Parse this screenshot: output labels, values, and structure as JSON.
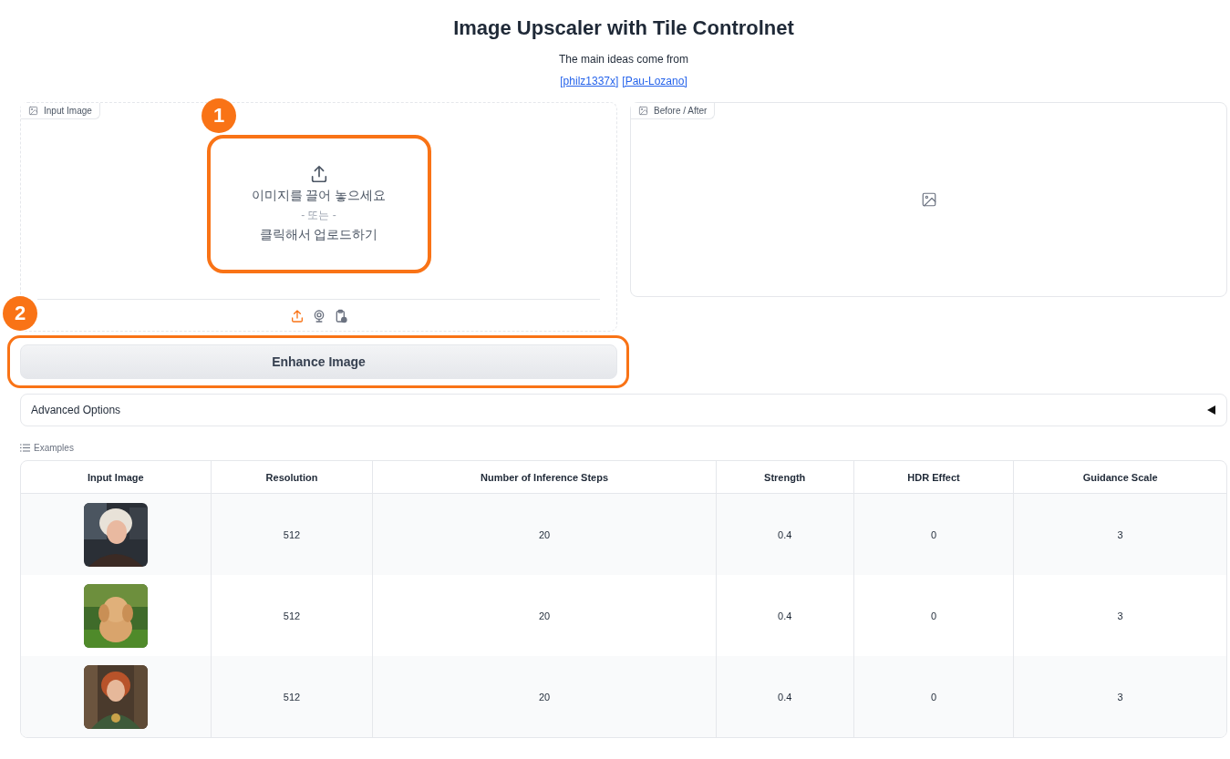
{
  "title": "Image Upscaler with Tile Controlnet",
  "subtitle": "The main ideas come from",
  "links": [
    "[philz1337x]",
    "[Pau-Lozano]"
  ],
  "input_image": {
    "label": "Input Image",
    "drop_text": "이미지를 끌어 놓으세요",
    "or_text": "- 또는 -",
    "click_text": "클릭해서 업로드하기",
    "sources": [
      {
        "kind": "upload",
        "selected": true
      },
      {
        "kind": "webcam",
        "selected": false
      },
      {
        "kind": "clipboard",
        "selected": false
      }
    ]
  },
  "output_image": {
    "label": "Before / After"
  },
  "annotations": [
    "1",
    "2"
  ],
  "button": "Enhance Image",
  "accordion": {
    "label": "Advanced Options",
    "expanded": false
  },
  "examples": {
    "label": "Examples",
    "columns": [
      "Input Image",
      "Resolution",
      "Number of Inference Steps",
      "Strength",
      "HDR Effect",
      "Guidance Scale"
    ],
    "rows": [
      {
        "cells": [
          {
            "kind": "picture"
          },
          "512",
          "20",
          "0.4",
          "0",
          "3"
        ]
      },
      {
        "cells": [
          {
            "kind": "picture"
          },
          "512",
          "20",
          "0.4",
          "0",
          "3"
        ]
      },
      {
        "cells": [
          {
            "kind": "picture"
          },
          "512",
          "20",
          "0.4",
          "0",
          "3"
        ]
      }
    ]
  }
}
